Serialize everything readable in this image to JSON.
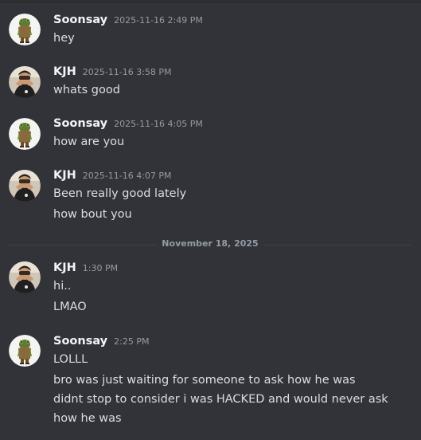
{
  "messages": [
    {
      "author": "Soonsay",
      "timestamp": "2025-11-16 2:49 PM",
      "lines": [
        "hey"
      ]
    },
    {
      "author": "KJH",
      "timestamp": "2025-11-16 3:58 PM",
      "lines": [
        "whats good"
      ]
    },
    {
      "author": "Soonsay",
      "timestamp": "2025-11-16 4:05 PM",
      "lines": [
        "how are you"
      ]
    },
    {
      "author": "KJH",
      "timestamp": "2025-11-16 4:07 PM",
      "lines": [
        "Been really good lately",
        "how bout you"
      ]
    },
    {
      "author": "KJH",
      "timestamp": "1:30 PM",
      "lines": [
        "hi..",
        "LMAO"
      ]
    },
    {
      "author": "Soonsay",
      "timestamp": "2:25 PM",
      "lines": [
        "LOLLL",
        "bro was just waiting for someone to ask how he was",
        "didnt stop to consider i was HACKED and would never ask how he was"
      ]
    }
  ],
  "date_divider": "November 18, 2025",
  "colors": {
    "background": "#313338",
    "username": "#f2f3f5",
    "message_text": "#dbdee1",
    "timestamp": "#949ba4",
    "divider_line": "#3f4147"
  },
  "avatars": {
    "soonsay": "frog-avatar-icon",
    "kjh": "person-photo-avatar-icon"
  }
}
